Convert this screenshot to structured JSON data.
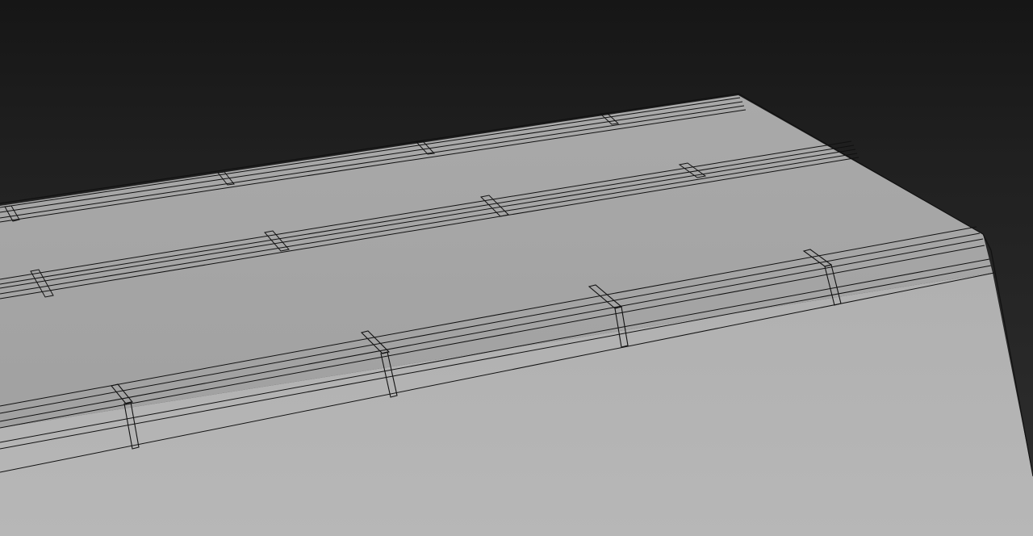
{
  "viewport": {
    "background_top": "#161616",
    "background_bottom": "#2f2f2f",
    "model_top_face": "#a8a8a8",
    "model_lower_face": "#b4b4b4",
    "model_side_face": "#ababab",
    "wireframe_color": "#111111"
  }
}
